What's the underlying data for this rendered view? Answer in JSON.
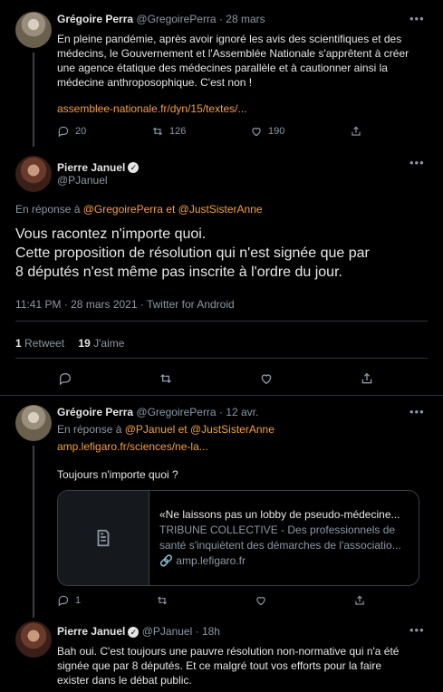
{
  "tweet1": {
    "author_name": "Grégoire Perra",
    "author_handle": "@GregoirePerra",
    "time": "· 28 mars",
    "text_lines": [
      "En pleine pandémie, après avoir ignoré les avis des scientifiques et des",
      "médecins,  le Gouvernement et l'Assemblée Nationale s'apprêtent à créer",
      "une agence étatique des médecines parallèle et à cautionner ainsi la",
      "médecine anthroposophique. C'est non !"
    ],
    "link": "assemblee-nationale.fr/dyn/15/textes/...",
    "reply_count": "20",
    "retweet_count": "126",
    "like_count": "190"
  },
  "main_tweet": {
    "author_name": "Pierre Januel",
    "author_handle": "@PJanuel",
    "reply_prefix": "En réponse à",
    "reply_user1": "@GregoirePerra",
    "reply_and": "et",
    "reply_user2": "@JustSisterAnne",
    "text_lines": [
      "Vous racontez n'importe quoi.",
      "Cette proposition de résolution qui n'est signée que par",
      "8 députés n'est même pas inscrite à l'ordre du jour."
    ],
    "meta": "11:41 PM · 28 mars 2021 · Twitter for Android",
    "retweet_num": "1",
    "retweet_label": "Retweet",
    "like_num": "19",
    "like_label": "J'aime"
  },
  "tweet3": {
    "author_name": "Grégoire Perra",
    "author_handle": "@GregoirePerra",
    "time": "· 12 avr.",
    "reply_prefix": "En réponse à",
    "reply_user1": "@PJanuel",
    "reply_and": "et",
    "reply_user2": "@JustSisterAnne",
    "link": "amp.lefigaro.fr/sciences/ne-la...",
    "text": "Toujours n'importe quoi ?",
    "card_title": "«Ne laissons pas un lobby de pseudo-médecine...",
    "card_desc_line1": "TRIBUNE COLLECTIVE - Des professionnels de",
    "card_desc_line2": "santé s'inquiètent des démarches de l'associatio...",
    "card_domain": "amp.lefigaro.fr",
    "reply_count": "1"
  },
  "tweet4": {
    "author_name": "Pierre Januel",
    "author_handle": "@PJanuel",
    "time": "· 18h",
    "text_lines": [
      "Bah oui. C'est toujours une pauvre résolution non-normative qui n'a été",
      "signée que par 8 députés. Et ce malgré tout vos efforts pour la faire",
      "exister dans le débat public."
    ]
  },
  "colors": {
    "background": "#000000",
    "accent_link": "#f4a03a",
    "muted": "#8b98a5"
  }
}
